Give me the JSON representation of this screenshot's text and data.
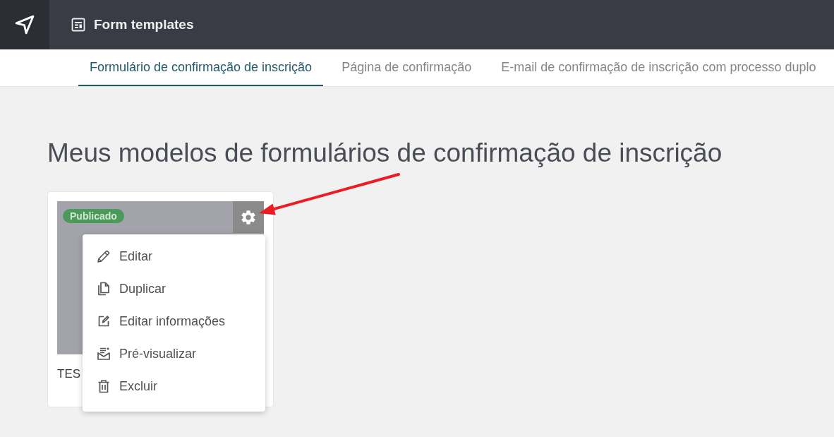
{
  "app_bar": {
    "title": "Form templates"
  },
  "tabs": [
    {
      "label": "Formulário de confirmação de inscrição",
      "selected": true
    },
    {
      "label": "Página de confirmação",
      "selected": false
    },
    {
      "label": "E-mail de confirmação de inscrição com processo duplo",
      "selected": false
    }
  ],
  "page": {
    "heading": "Meus modelos de formulários de confirmação de inscrição"
  },
  "templates": [
    {
      "title": "TES",
      "status": "Publicado",
      "menu_open": true,
      "menu_items": [
        {
          "kind": "edit",
          "label": "Editar"
        },
        {
          "kind": "duplicate",
          "label": "Duplicar"
        },
        {
          "kind": "info",
          "label": "Editar informações"
        },
        {
          "kind": "preview",
          "label": "Pré-visualizar"
        },
        {
          "kind": "delete",
          "label": "Excluir"
        }
      ]
    }
  ]
}
